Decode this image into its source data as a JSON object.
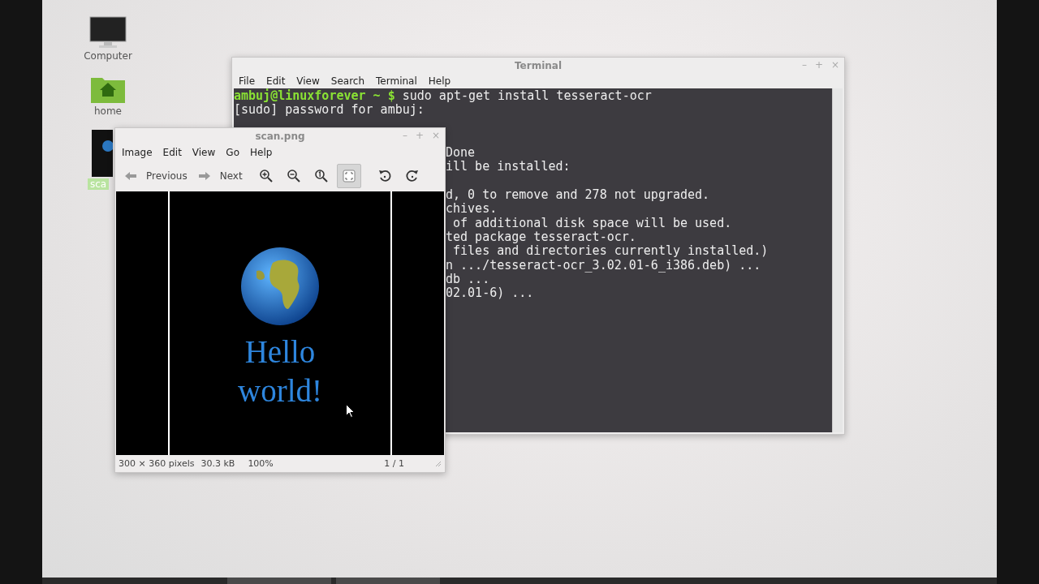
{
  "desktop_icons": [
    {
      "kind": "computer",
      "label": "Computer",
      "selected": false
    },
    {
      "kind": "folder-home",
      "label": "home",
      "selected": false
    },
    {
      "kind": "image",
      "label": "sca",
      "selected": true
    }
  ],
  "terminal": {
    "title": "Terminal",
    "controls": [
      "–",
      "+",
      "×"
    ],
    "menu": [
      "File",
      "Edit",
      "View",
      "Search",
      "Terminal",
      "Help"
    ],
    "prompt": "ambuj@linuxforever ~ $",
    "command": "sudo apt-get install tesseract-ocr",
    "lines": [
      {
        "kind": "full",
        "text": "[sudo] password for ambuj:"
      },
      {
        "kind": "full"
      },
      {
        "kind": "clipped"
      },
      {
        "kind": "clipped",
        "text": "Done"
      },
      {
        "kind": "clipped",
        "text": "ill be installed:"
      },
      {
        "kind": "clipped"
      },
      {
        "kind": "clipped",
        "text": "d, 0 to remove and 278 not upgraded."
      },
      {
        "kind": "clipped",
        "text": "chives."
      },
      {
        "kind": "clipped",
        "text": " of additional disk space will be used."
      },
      {
        "kind": "clipped",
        "text": "ted package tesseract-ocr."
      },
      {
        "kind": "clipped",
        "text": " files and directories currently installed.)"
      },
      {
        "kind": "clipped",
        "text": "n .../tesseract-ocr_3.02.01-6_i386.deb) ..."
      },
      {
        "kind": "clipped",
        "text": "db ..."
      },
      {
        "kind": "clipped",
        "text": "02.01-6) ..."
      }
    ]
  },
  "viewer": {
    "title": "scan.png",
    "controls": [
      "–",
      "+",
      "×"
    ],
    "menu": [
      "Image",
      "Edit",
      "View",
      "Go",
      "Help"
    ],
    "nav": [
      {
        "kind": "previous",
        "label": "Previous"
      },
      {
        "kind": "next",
        "label": "Next"
      }
    ],
    "tools": [
      {
        "kind": "zoom-in",
        "pressed": false
      },
      {
        "kind": "zoom-out",
        "pressed": false
      },
      {
        "kind": "zoom-normal",
        "pressed": false
      },
      {
        "kind": "fit",
        "pressed": true
      },
      {
        "kind": "rotate-left",
        "pressed": false
      },
      {
        "kind": "rotate-right",
        "pressed": false
      }
    ],
    "image_text": [
      "Hello",
      "world!"
    ],
    "status": {
      "size": "300 × 360 pixels",
      "filesize": "30.3 kB",
      "zoom": "100%",
      "page": "1 / 1"
    }
  }
}
